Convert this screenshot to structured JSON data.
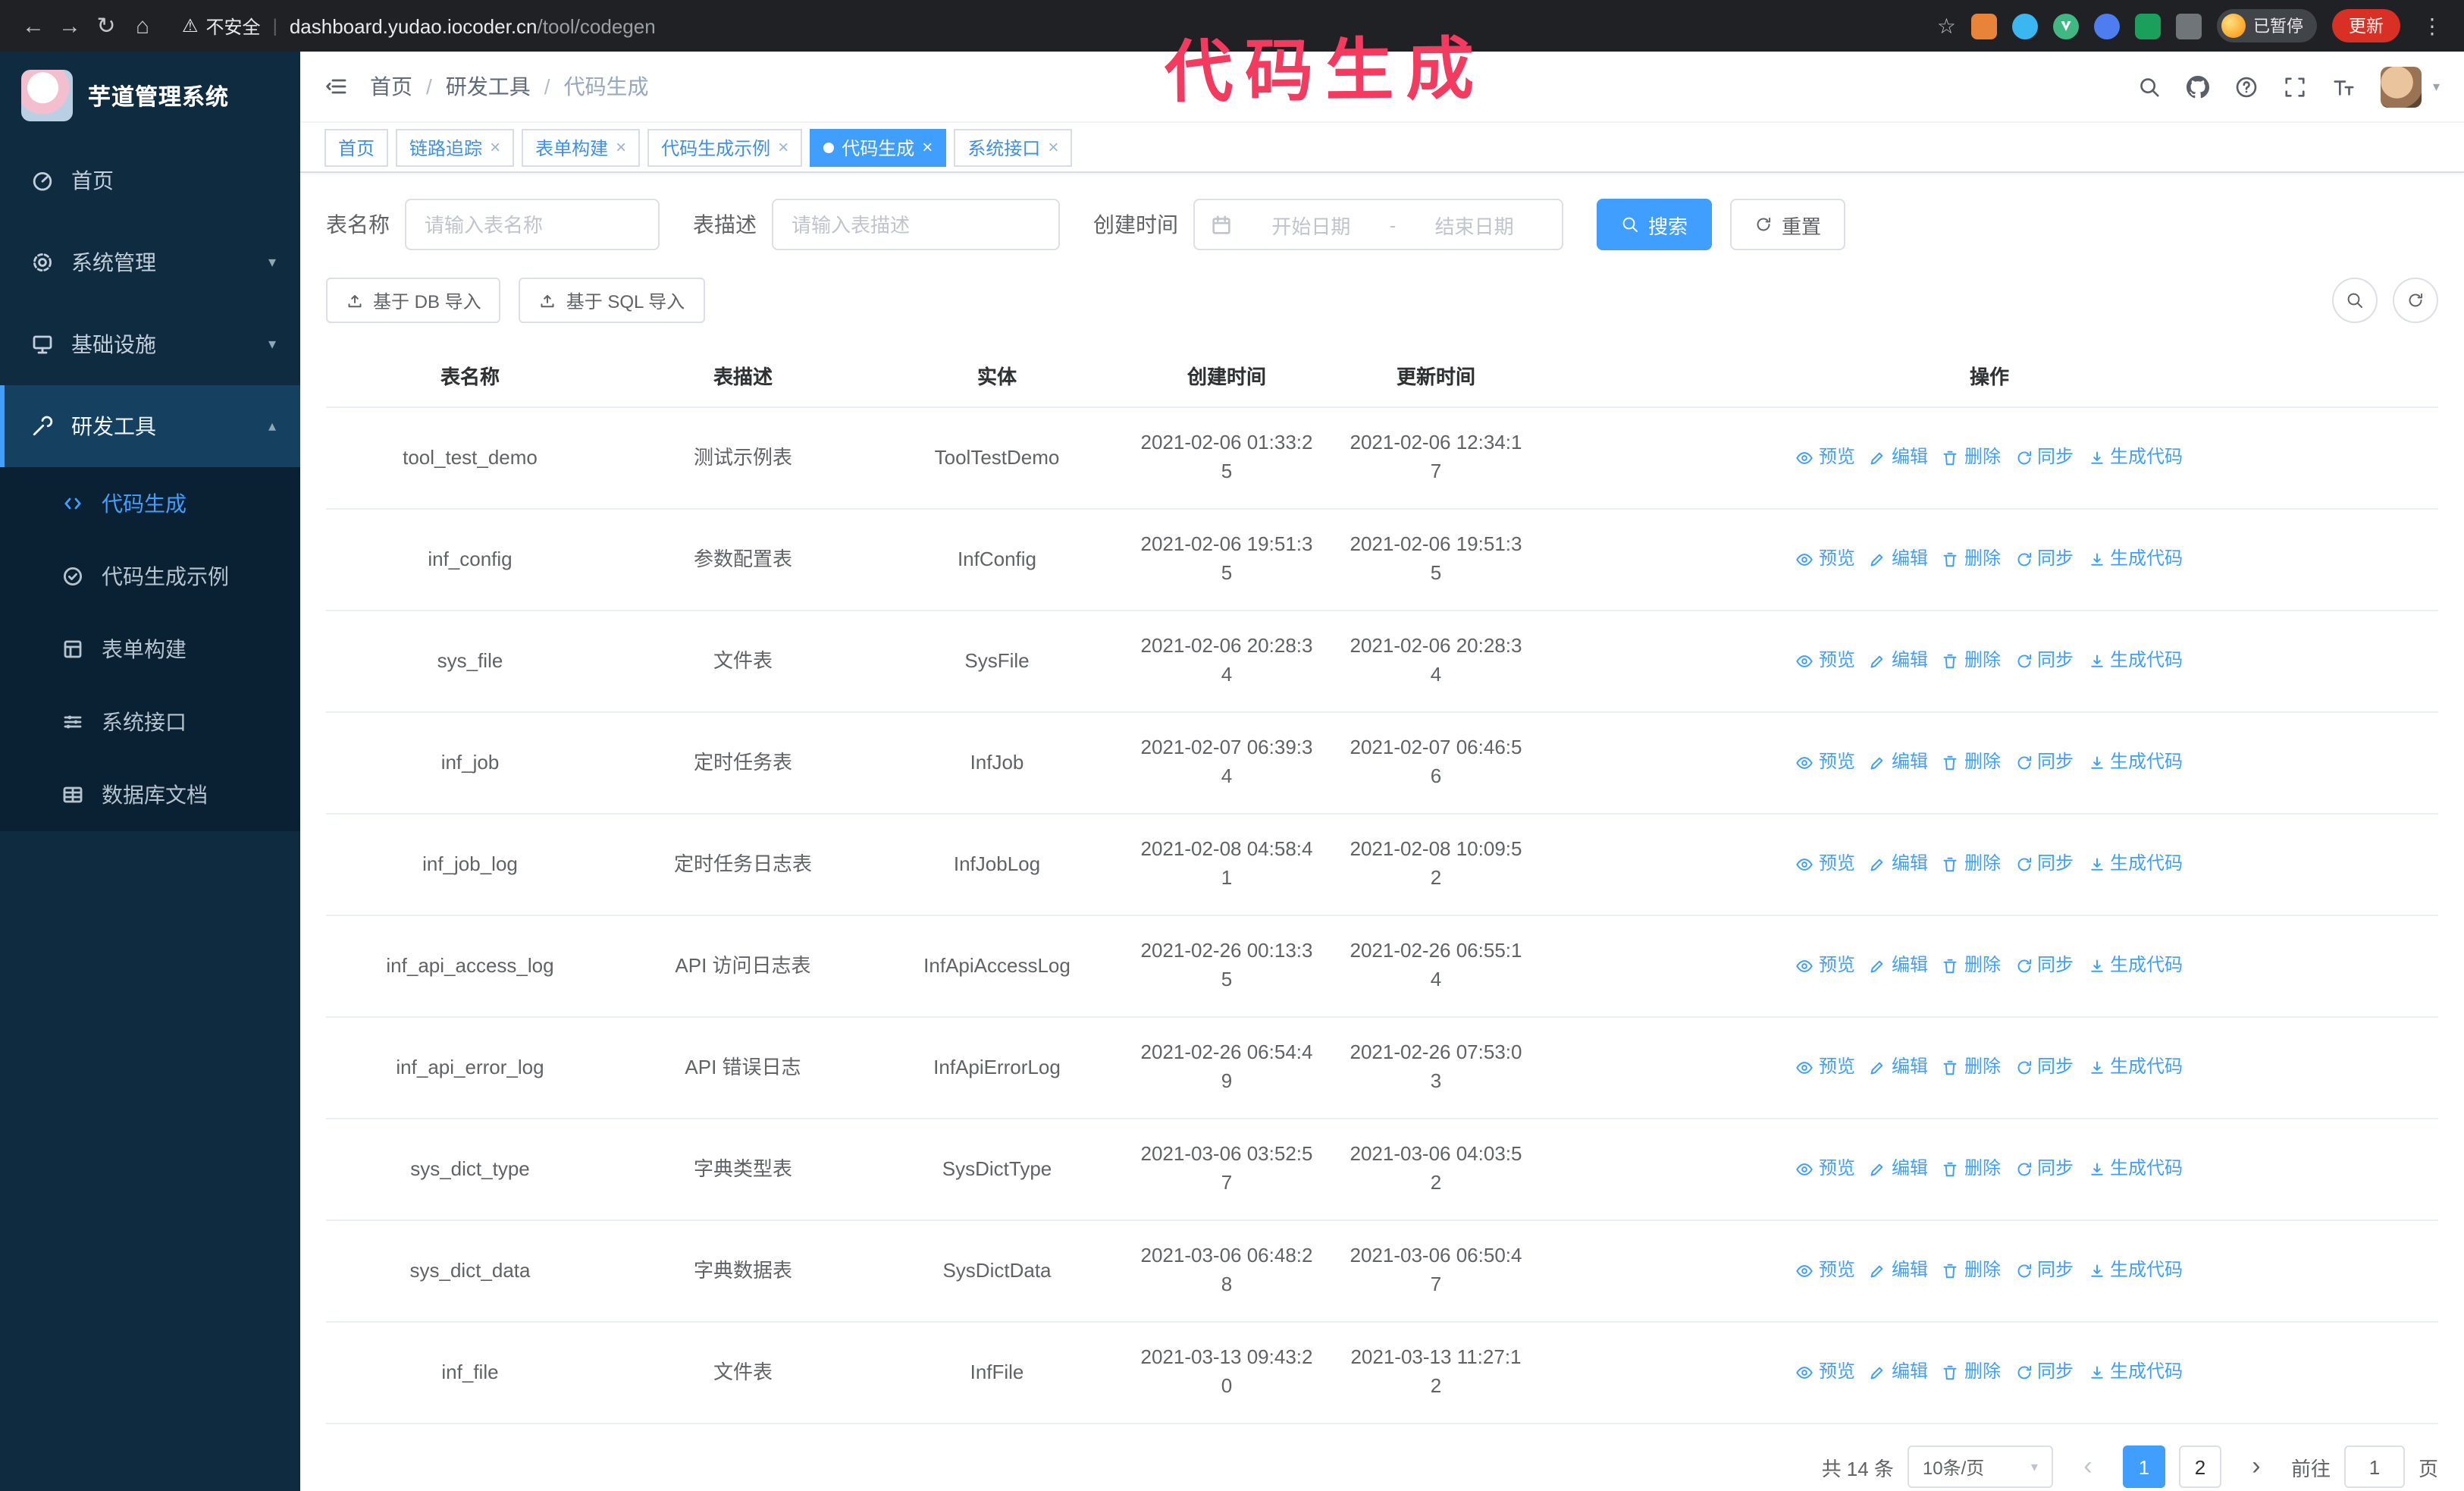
{
  "browser": {
    "security_warning": "不安全",
    "url_host": "dashboard.yudao.iocoder.cn",
    "url_path": "/tool/codegen",
    "paused_badge": "已暂停",
    "update_button": "更新"
  },
  "annotation": {
    "text": "代码生成",
    "color": "#f43a5f"
  },
  "colors": {
    "primary": "#409eff",
    "sidebar_bg": "#0e2b40",
    "submenu_bg": "#0a2133",
    "annotation": "#f43a5f",
    "update_button": "#d93025",
    "active_tab": "#409eff"
  },
  "icons": {
    "back": "←",
    "forward": "→",
    "reload": "↻",
    "home": "⌂",
    "warning": "⚠",
    "divider": "|",
    "star": "☆",
    "menu_dots": "⋮",
    "close": "×",
    "caret_down": "▾",
    "caret_up": "▴",
    "breadcrumb_separator": "/",
    "prev": "‹",
    "next": "›"
  },
  "sidebar": {
    "app_title": "芋道管理系统",
    "items": [
      {
        "icon": "dashboard-icon",
        "label": "首页"
      },
      {
        "icon": "gear-icon",
        "label": "系统管理"
      },
      {
        "icon": "infrastructure-icon",
        "label": "基础设施"
      },
      {
        "icon": "tools-icon",
        "label": "研发工具",
        "expanded": true
      }
    ],
    "submenu": [
      {
        "icon": "code-icon",
        "label": "代码生成",
        "active": true
      },
      {
        "icon": "example-icon",
        "label": "代码生成示例"
      },
      {
        "icon": "form-icon",
        "label": "表单构建"
      },
      {
        "icon": "api-icon",
        "label": "系统接口"
      },
      {
        "icon": "database-icon",
        "label": "数据库文档"
      }
    ]
  },
  "header": {
    "breadcrumb": [
      "首页",
      "研发工具",
      "代码生成"
    ],
    "separator": "/"
  },
  "tabs": [
    {
      "label": "首页",
      "closable": false,
      "active": false
    },
    {
      "label": "链路追踪",
      "closable": true,
      "active": false
    },
    {
      "label": "表单构建",
      "closable": true,
      "active": false
    },
    {
      "label": "代码生成示例",
      "closable": true,
      "active": false
    },
    {
      "label": "代码生成",
      "closable": true,
      "active": true
    },
    {
      "label": "系统接口",
      "closable": true,
      "active": false
    }
  ],
  "filters": {
    "table_name_label": "表名称",
    "table_name_placeholder": "请输入表名称",
    "table_name_value": "",
    "table_desc_label": "表描述",
    "table_desc_placeholder": "请输入表描述",
    "table_desc_value": "",
    "create_time_label": "创建时间",
    "date_start_placeholder": "开始日期",
    "date_separator": "-",
    "date_end_placeholder": "结束日期",
    "search_button": "搜索",
    "reset_button": "重置"
  },
  "toolbar": {
    "import_db": "基于 DB 导入",
    "import_sql": "基于 SQL 导入"
  },
  "table": {
    "columns": [
      "表名称",
      "表描述",
      "实体",
      "创建时间",
      "更新时间",
      "操作"
    ],
    "actions": [
      "预览",
      "编辑",
      "删除",
      "同步",
      "生成代码"
    ],
    "rows": [
      {
        "name": "tool_test_demo",
        "desc": "测试示例表",
        "entity": "ToolTestDemo",
        "created": "2021-02-06 01:33:25",
        "updated": "2021-02-06 12:34:17"
      },
      {
        "name": "inf_config",
        "desc": "参数配置表",
        "entity": "InfConfig",
        "created": "2021-02-06 19:51:35",
        "updated": "2021-02-06 19:51:35"
      },
      {
        "name": "sys_file",
        "desc": "文件表",
        "entity": "SysFile",
        "created": "2021-02-06 20:28:34",
        "updated": "2021-02-06 20:28:34"
      },
      {
        "name": "inf_job",
        "desc": "定时任务表",
        "entity": "InfJob",
        "created": "2021-02-07 06:39:34",
        "updated": "2021-02-07 06:46:56"
      },
      {
        "name": "inf_job_log",
        "desc": "定时任务日志表",
        "entity": "InfJobLog",
        "created": "2021-02-08 04:58:41",
        "updated": "2021-02-08 10:09:52"
      },
      {
        "name": "inf_api_access_log",
        "desc": "API 访问日志表",
        "entity": "InfApiAccessLog",
        "created": "2021-02-26 00:13:35",
        "updated": "2021-02-26 06:55:14"
      },
      {
        "name": "inf_api_error_log",
        "desc": "API 错误日志",
        "entity": "InfApiErrorLog",
        "created": "2021-02-26 06:54:49",
        "updated": "2021-02-26 07:53:03"
      },
      {
        "name": "sys_dict_type",
        "desc": "字典类型表",
        "entity": "SysDictType",
        "created": "2021-03-06 03:52:57",
        "updated": "2021-03-06 04:03:52"
      },
      {
        "name": "sys_dict_data",
        "desc": "字典数据表",
        "entity": "SysDictData",
        "created": "2021-03-06 06:48:28",
        "updated": "2021-03-06 06:50:47"
      },
      {
        "name": "inf_file",
        "desc": "文件表",
        "entity": "InfFile",
        "created": "2021-03-13 09:43:20",
        "updated": "2021-03-13 11:27:12"
      }
    ]
  },
  "pagination": {
    "total": "共 14 条",
    "page_size": "10条/页",
    "prev": "‹",
    "next": "›",
    "pages": [
      "1",
      "2"
    ],
    "active_page": "1",
    "goto_prefix": "前往",
    "goto_value": "1",
    "goto_suffix": "页"
  }
}
